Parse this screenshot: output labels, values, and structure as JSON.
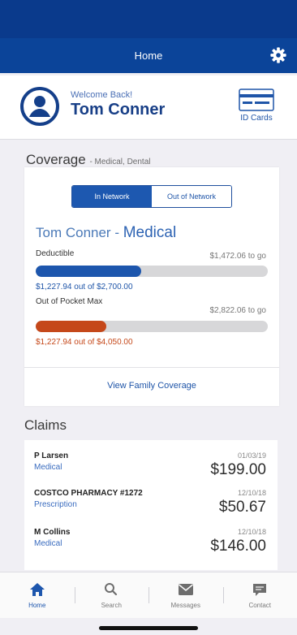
{
  "nav": {
    "title": "Home"
  },
  "welcome": {
    "greeting": "Welcome Back!",
    "name": "Tom Conner",
    "id_cards_label": "ID Cards"
  },
  "coverage": {
    "heading": "Coverage",
    "subheading": "- Medical, Dental",
    "toggle": {
      "in_network": "In Network",
      "out_of_network": "Out of Network",
      "selected": "In Network"
    },
    "plan": {
      "member": "Tom Conner",
      "separator": " - ",
      "type": "Medical"
    },
    "deductible": {
      "label": "Deductible",
      "remaining": "$1,472.06 to go",
      "progress_text": "$1,227.94 out of $2,700.00",
      "progress_fraction": 0.455
    },
    "out_of_pocket": {
      "label": "Out of Pocket Max",
      "remaining": "$2,822.06 to go",
      "progress_text": "$1,227.94 out of $4,050.00",
      "progress_fraction": 0.303
    },
    "family_link": "View Family Coverage"
  },
  "claims": {
    "heading": "Claims",
    "items": [
      {
        "name": "P Larsen",
        "type": "Medical",
        "date": "01/03/19",
        "amount": "$199.00"
      },
      {
        "name": "COSTCO PHARMACY #1272",
        "type": "Prescription",
        "date": "12/10/18",
        "amount": "$50.67"
      },
      {
        "name": "M Collins",
        "type": "Medical",
        "date": "12/10/18",
        "amount": "$146.00"
      }
    ]
  },
  "tabs": [
    {
      "label": "Home",
      "icon": "home-icon",
      "active": true
    },
    {
      "label": "Search",
      "icon": "search-icon",
      "active": false
    },
    {
      "label": "Messages",
      "icon": "envelope-icon",
      "active": false
    },
    {
      "label": "Contact",
      "icon": "chat-icon",
      "active": false
    }
  ],
  "colors": {
    "primary": "#0b4499",
    "accent_blue": "#1d56ad",
    "accent_orange": "#c5481a"
  }
}
